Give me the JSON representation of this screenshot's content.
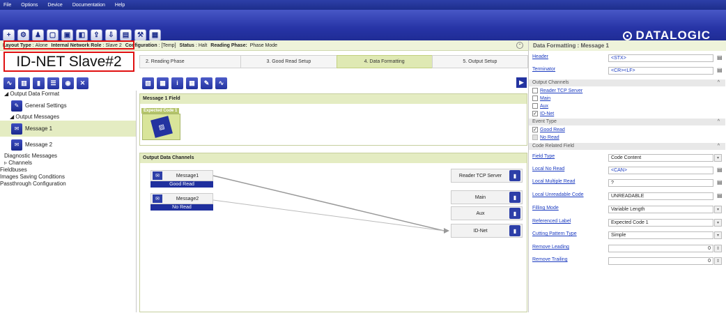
{
  "menu": [
    "File",
    "Options",
    "Device",
    "Documentation",
    "Help"
  ],
  "toolbar_icons": [
    "add-icon",
    "gear-icon",
    "person-icon",
    "window-icon",
    "monitor-icon",
    "device-icon",
    "upload-icon",
    "download-icon",
    "save-icon",
    "settings-icon",
    "pictures-icon"
  ],
  "logo": "DATALOGIC",
  "status": {
    "layout_label": "Layout Type",
    "layout_value": "Alone",
    "role_label": "Internal Network Role",
    "role_value": "Slave 2",
    "config_label": "Configuration",
    "config_value": "[Temp]",
    "status_label": "Status",
    "status_value": "Halt",
    "phase_label": "Reading Phase:",
    "phase_value": "Phase Mode"
  },
  "slave_label": "ID-NET Slave#2",
  "phases": [
    "2. Reading Phase",
    "3. Good Read Setup",
    "4. Data Formatting",
    "5. Output Setup"
  ],
  "tree": {
    "output_data_format": "Output Data Format",
    "general_settings": "General Settings",
    "output_messages": "Output Messages",
    "message1": "Message 1",
    "message2": "Message 2",
    "diagnostic": "Diagnostic Messages",
    "channels": "Channels",
    "fieldbuses": "Fieldbuses",
    "images": "Images Saving Conditions",
    "passthrough": "Passthrough Configuration"
  },
  "message_panel": {
    "title": "Message 1 Field",
    "code_label": "Expected Code 1"
  },
  "channels_panel": {
    "title": "Output Data Channels",
    "messages": [
      {
        "name": "Message1",
        "status": "Good Read"
      },
      {
        "name": "Message2",
        "status": "No Read"
      }
    ],
    "channels": [
      "Reader TCP Server",
      "Main",
      "Aux",
      "ID-Net"
    ]
  },
  "right": {
    "title": "Data Formatting  :  Message 1",
    "header_label": "Header",
    "header_value": "<STX>",
    "terminator_label": "Terminator",
    "terminator_value": "<CR><LF>",
    "output_channels": "Output Channels",
    "oc_items": [
      "Reader TCP Server",
      "Main",
      "Aux",
      "ID-Net"
    ],
    "event_type": "Event Type",
    "good_read": "Good Read",
    "no_read": "No Read",
    "code_related": "Code Related Field",
    "field_type_label": "Field Type",
    "field_type_value": "Code Content",
    "local_no_read_label": "Local No Read",
    "local_no_read_value": "<CAN>",
    "local_multiple_label": "Local Multiple Read",
    "local_multiple_value": "?",
    "local_unread_label": "Local Unreadable Code",
    "local_unread_value": "UNREADABLE",
    "filling_label": "Filling Mode",
    "filling_value": "Variable Length",
    "ref_label": "Referenced Label",
    "ref_value": "Expected Code  1",
    "cutting_label": "Cutting Pattern Type",
    "cutting_value": "Simple",
    "remove_leading_label": "Remove Leading",
    "remove_leading_value": "0",
    "remove_trailing_label": "Remove Trailing",
    "remove_trailing_value": "0"
  },
  "colors": {
    "accent": "#2333a0",
    "highlight": "#dfe9b3",
    "annotation": "#e01010"
  }
}
